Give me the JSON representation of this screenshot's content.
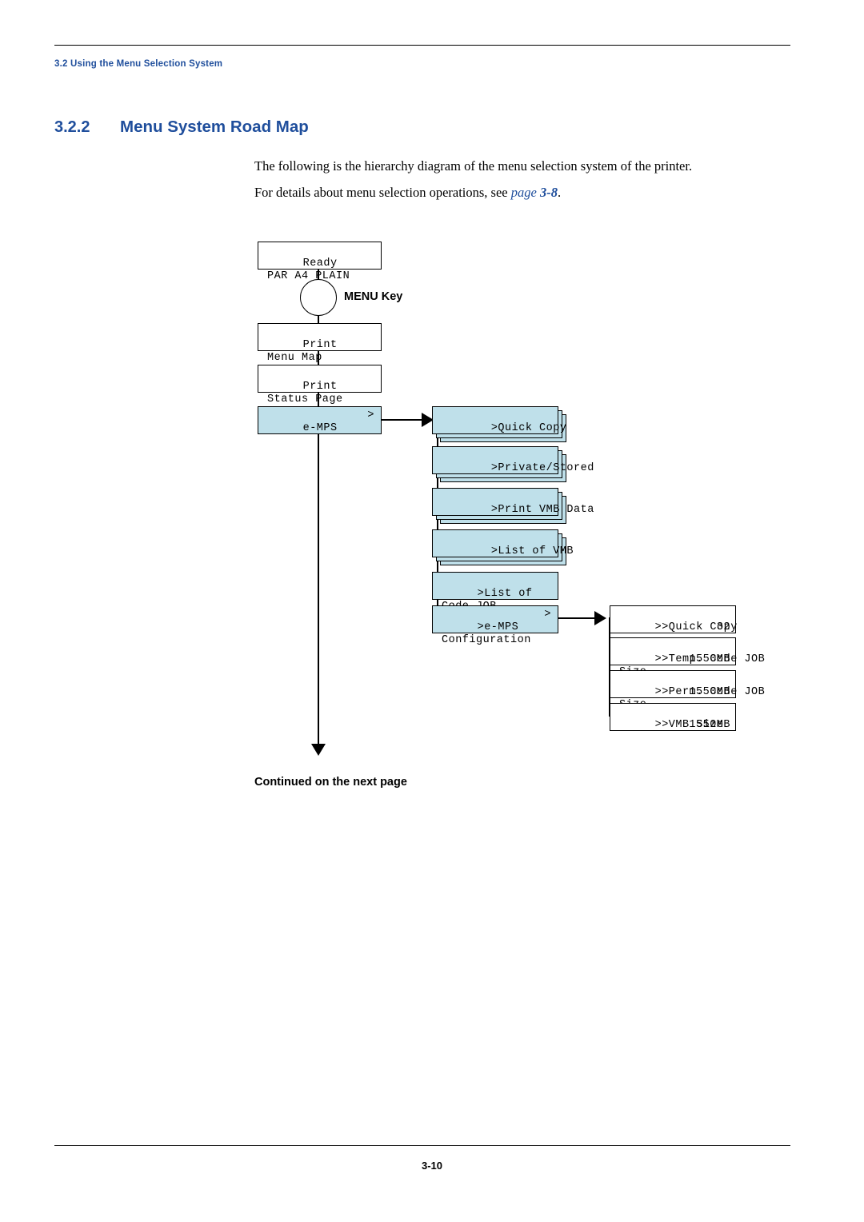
{
  "header": {
    "running_head": "3.2 Using the Menu Selection System"
  },
  "title": {
    "number": "3.2.2",
    "text": "Menu System Road Map"
  },
  "body": {
    "paragraph1": "The following is the hierarchy diagram of the menu selection system of the printer.",
    "paragraph2_prefix": "For details about menu selection operations, see ",
    "paragraph2_xref": "page 3-8",
    "paragraph2_suffix": "."
  },
  "diagram": {
    "menu_key_label": "MENU Key",
    "continued_label": "Continued on the next page",
    "column1": [
      {
        "line1": "Ready",
        "line2": "PAR A4 PLAIN"
      },
      {
        "line1": "Print",
        "line2": "Menu Map"
      },
      {
        "line1": "Print",
        "line2": "Status Page"
      },
      {
        "line1": "e-MPS",
        "line2": "",
        "marker": ">"
      }
    ],
    "column2": [
      {
        "line1": ">Quick Copy",
        "line2": "",
        "stacked": true
      },
      {
        "line1": ">Private/Stored",
        "line2": "",
        "stacked": true
      },
      {
        "line1": ">Print VMB Data",
        "line2": "",
        "stacked": true
      },
      {
        "line1": ">List of VMB",
        "line2": "",
        "stacked": true
      },
      {
        "line1": ">List of",
        "line2": "Code JOB",
        "stacked": false
      },
      {
        "line1": ">e-MPS",
        "line2": "Configuration",
        "marker": ">",
        "stacked": false
      }
    ],
    "column3": [
      {
        "line1": ">>Quick Copy",
        "line2": "",
        "value2": "32"
      },
      {
        "line1": ">>Temp. Code JOB",
        "line2": "Size",
        "value2": "1550MB"
      },
      {
        "line1": ">>Perm. Code JOB",
        "line2": "Size",
        "value2": "1550MB"
      },
      {
        "line1": ">>VMB Size",
        "line2": "",
        "value2": "1550MB"
      }
    ]
  },
  "footer": {
    "page_number": "3-10"
  },
  "colors": {
    "accent": "#1f4e9c",
    "lcd_fill": "#bfe0ea"
  }
}
